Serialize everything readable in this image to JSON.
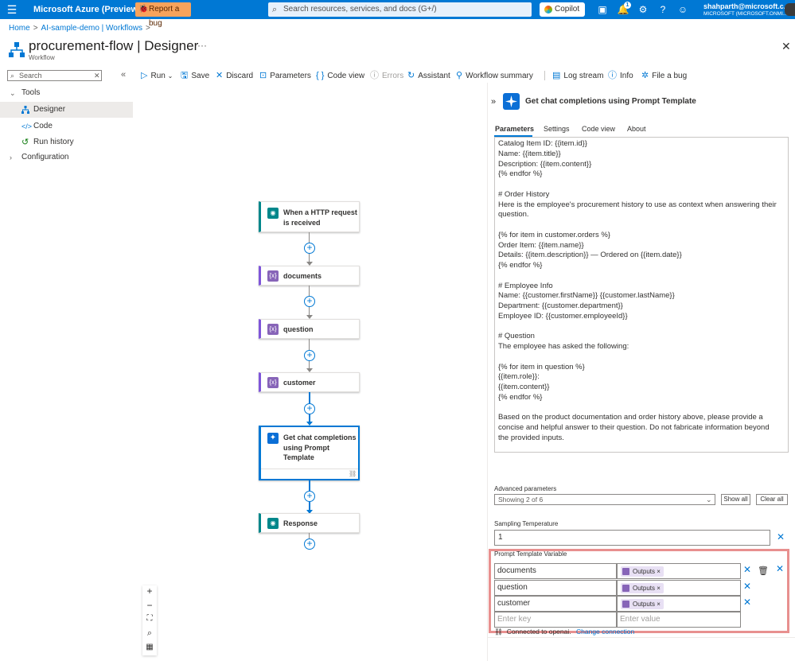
{
  "topbar": {
    "brand": "Microsoft Azure (Preview)",
    "report_bug": "Report a bug",
    "search_placeholder": "Search resources, services, and docs (G+/)",
    "copilot": "Copilot",
    "notification_count": "1",
    "user_email": "shahparth@microsoft.c...",
    "user_tenant": "MICROSOFT (MICROSOFT.ONMI..."
  },
  "breadcrumb": {
    "home": "Home",
    "item1": "AI-sample-demo | Workflows"
  },
  "header": {
    "title_name": "procurement-flow",
    "title_section": "| Designer",
    "subtitle": "Workflow",
    "more": "···"
  },
  "sidebar": {
    "search_placeholder": "Search",
    "items": [
      {
        "label": "Tools"
      },
      {
        "label": "Designer"
      },
      {
        "label": "Code"
      },
      {
        "label": "Run history"
      },
      {
        "label": "Configuration"
      }
    ]
  },
  "toolbar": {
    "run": "Run",
    "save": "Save",
    "discard": "Discard",
    "parameters": "Parameters",
    "code_view": "Code view",
    "errors": "Errors",
    "assistant": "Assistant",
    "workflow_summary": "Workflow summary",
    "log_stream": "Log stream",
    "info": "Info",
    "file_bug": "File a bug"
  },
  "canvas": {
    "nodes": [
      {
        "label_line1": "When a HTTP request",
        "label_line2": "is received"
      },
      {
        "label": "documents"
      },
      {
        "label": "question"
      },
      {
        "label": "customer"
      },
      {
        "label_line1": "Get chat completions",
        "label_line2": "using Prompt",
        "label_line3": "Template"
      },
      {
        "label": "Response"
      }
    ]
  },
  "panel": {
    "title": "Get chat completions using Prompt Template",
    "tabs": [
      "Parameters",
      "Settings",
      "Code view",
      "About"
    ],
    "active_tab": "Parameters",
    "prompt_text": "Catalog Item ID: {{item.id}}\nName: {{item.title}}\nDescription: {{item.content}}\n{% endfor %}\n\n# Order History\nHere is the employee's procurement history to use as context when answering their question.\n\n{% for item in customer.orders %}\nOrder Item: {{item.name}}\nDetails: {{item.description}} — Ordered on {{item.date}}\n{% endfor %}\n\n# Employee Info\nName: {{customer.firstName}} {{customer.lastName}}\nDepartment: {{customer.department}}\nEmployee ID: {{customer.employeeId}}\n\n# Question\nThe employee has asked the following:\n\n{% for item in question %}\n{{item.role}}:\n{{item.content}}\n{% endfor %}\n\nBased on the product documentation and order history above, please provide a concise and helpful answer to their question. Do not fabricate information beyond the provided inputs.",
    "advanced_label": "Advanced parameters",
    "advanced_value": "Showing 2 of 6",
    "show_all": "Show all",
    "clear_all": "Clear all",
    "temperature_label": "Sampling Temperature",
    "temperature_value": "1",
    "ptv_label": "Prompt Template Variable",
    "ptv_rows": [
      {
        "key": "documents",
        "value": "Outputs"
      },
      {
        "key": "question",
        "value": "Outputs"
      },
      {
        "key": "customer",
        "value": "Outputs"
      }
    ],
    "key_placeholder": "Enter key",
    "value_placeholder": "Enter value",
    "connection_text": "Connected to openai.",
    "change_connection": "Change connection"
  },
  "colors": {
    "azure_blue": "#0078d4",
    "bug_orange": "#f7a35c",
    "variable_purple": "#8764b8",
    "trigger_teal": "#00878b",
    "highlight_red": "#e8908f"
  }
}
